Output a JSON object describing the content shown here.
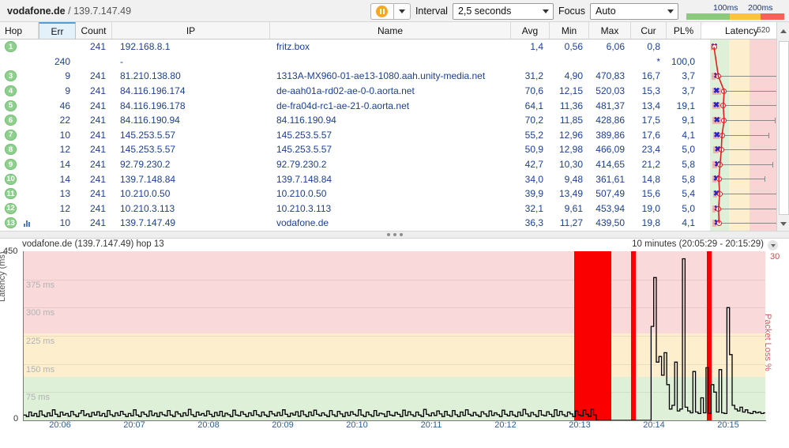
{
  "header": {
    "target_host": "vodafone.de",
    "separator": " / ",
    "target_ip": "139.7.147.49",
    "pause_icon": "pause-icon",
    "dropdown_icon": "chevron-down-icon",
    "interval_label": "Interval",
    "interval_value": "2,5 seconds",
    "focus_label": "Focus",
    "focus_value": "Auto",
    "legend": {
      "tick_100": "100ms",
      "tick_200": "200ms",
      "color_green": "#8cc97f",
      "color_amber": "#fbc343",
      "color_red": "#f4635a"
    }
  },
  "table": {
    "columns": [
      {
        "key": "hop",
        "label": "Hop",
        "sorted": false
      },
      {
        "key": "err",
        "label": "Err",
        "sorted": true
      },
      {
        "key": "count",
        "label": "Count",
        "sorted": false
      },
      {
        "key": "ip",
        "label": "IP",
        "sorted": false
      },
      {
        "key": "name",
        "label": "Name",
        "sorted": false
      },
      {
        "key": "avg",
        "label": "Avg",
        "sorted": false
      },
      {
        "key": "min",
        "label": "Min",
        "sorted": false
      },
      {
        "key": "max",
        "label": "Max",
        "sorted": false
      },
      {
        "key": "cur",
        "label": "Cur",
        "sorted": false
      },
      {
        "key": "pl",
        "label": "PL%",
        "sorted": false
      },
      {
        "key": "lat",
        "label": "Latency",
        "sorted": false
      }
    ],
    "latency_scale_max": "520",
    "rows": [
      {
        "hop": "1",
        "err": "",
        "count": "241",
        "ip": "192.168.8.1",
        "name": "fritz.box",
        "avg": "1,4",
        "min": "0,56",
        "max": "6,06",
        "cur": "0,8",
        "pl": "",
        "graph": {
          "avg_pct": 0.3,
          "min_pct": 0.1,
          "max_pct": 1.2,
          "cur_pct": 0.2
        }
      },
      {
        "hop": "",
        "err": "240",
        "count": "",
        "ip": "-",
        "name": "",
        "avg": "",
        "min": "",
        "max": "",
        "cur": "*",
        "pl": "100,0",
        "graph": null
      },
      {
        "hop": "3",
        "err": "9",
        "count": "241",
        "ip": "81.210.138.80",
        "name": "1313A-MX960-01-ae13-1080.aah.unity-media.net",
        "avg": "31,2",
        "min": "4,90",
        "max": "470,83",
        "cur": "16,7",
        "pl": "3,7",
        "graph": {
          "avg_pct": 6.0,
          "min_pct": 0.9,
          "max_pct": 90.5,
          "cur_pct": 3.2
        }
      },
      {
        "hop": "4",
        "err": "9",
        "count": "241",
        "ip": "84.116.196.174",
        "name": "de-aah01a-rd02-ae-0-0.aorta.net",
        "avg": "70,6",
        "min": "12,15",
        "max": "520,03",
        "cur": "15,3",
        "pl": "3,7",
        "graph": {
          "avg_pct": 13.6,
          "min_pct": 2.3,
          "max_pct": 100.0,
          "cur_pct": 2.9
        }
      },
      {
        "hop": "5",
        "err": "46",
        "count": "241",
        "ip": "84.116.196.178",
        "name": "de-fra04d-rc1-ae-21-0.aorta.net",
        "avg": "64,1",
        "min": "11,36",
        "max": "481,37",
        "cur": "13,4",
        "pl": "19,1",
        "graph": {
          "avg_pct": 12.3,
          "min_pct": 2.2,
          "max_pct": 92.6,
          "cur_pct": 2.6
        }
      },
      {
        "hop": "6",
        "err": "22",
        "count": "241",
        "ip": "84.116.190.94",
        "name": "84.116.190.94",
        "avg": "70,2",
        "min": "11,85",
        "max": "428,86",
        "cur": "17,5",
        "pl": "9,1",
        "graph": {
          "avg_pct": 13.5,
          "min_pct": 2.3,
          "max_pct": 82.5,
          "cur_pct": 3.4
        }
      },
      {
        "hop": "7",
        "err": "10",
        "count": "241",
        "ip": "145.253.5.57",
        "name": "145.253.5.57",
        "avg": "55,2",
        "min": "12,96",
        "max": "389,86",
        "cur": "17,6",
        "pl": "4,1",
        "graph": {
          "avg_pct": 10.6,
          "min_pct": 2.5,
          "max_pct": 75.0,
          "cur_pct": 3.4
        }
      },
      {
        "hop": "8",
        "err": "12",
        "count": "241",
        "ip": "145.253.5.57",
        "name": "145.253.5.57",
        "avg": "50,9",
        "min": "12,98",
        "max": "466,09",
        "cur": "23,4",
        "pl": "5,0",
        "graph": {
          "avg_pct": 9.8,
          "min_pct": 2.5,
          "max_pct": 89.6,
          "cur_pct": 4.5
        }
      },
      {
        "hop": "9",
        "err": "14",
        "count": "241",
        "ip": "92.79.230.2",
        "name": "92.79.230.2",
        "avg": "42,7",
        "min": "10,30",
        "max": "414,65",
        "cur": "21,2",
        "pl": "5,8",
        "graph": {
          "avg_pct": 8.2,
          "min_pct": 2.0,
          "max_pct": 79.7,
          "cur_pct": 4.1
        }
      },
      {
        "hop": "10",
        "err": "14",
        "count": "241",
        "ip": "139.7.148.84",
        "name": "139.7.148.84",
        "avg": "34,0",
        "min": "9,48",
        "max": "361,61",
        "cur": "14,8",
        "pl": "5,8",
        "graph": {
          "avg_pct": 6.5,
          "min_pct": 1.8,
          "max_pct": 69.5,
          "cur_pct": 2.8
        }
      },
      {
        "hop": "11",
        "err": "13",
        "count": "241",
        "ip": "10.210.0.50",
        "name": "10.210.0.50",
        "avg": "39,9",
        "min": "13,49",
        "max": "507,49",
        "cur": "15,6",
        "pl": "5,4",
        "graph": {
          "avg_pct": 7.7,
          "min_pct": 2.6,
          "max_pct": 97.6,
          "cur_pct": 3.0
        }
      },
      {
        "hop": "12",
        "err": "12",
        "count": "241",
        "ip": "10.210.3.113",
        "name": "10.210.3.113",
        "avg": "32,1",
        "min": "9,61",
        "max": "453,94",
        "cur": "19,0",
        "pl": "5,0",
        "graph": {
          "avg_pct": 6.2,
          "min_pct": 1.8,
          "max_pct": 87.3,
          "cur_pct": 3.7
        }
      },
      {
        "hop": "13",
        "err": "10",
        "count": "241",
        "ip": "139.7.147.49",
        "name": "vodafone.de",
        "avg": "36,3",
        "min": "11,27",
        "max": "439,50",
        "cur": "19,8",
        "pl": "4,1",
        "graph": {
          "avg_pct": 7.0,
          "min_pct": 2.2,
          "max_pct": 84.5,
          "cur_pct": 3.8
        },
        "selected": true
      }
    ]
  },
  "chart": {
    "title": "vodafone.de (139.7.147.49) hop 13",
    "range_label": "10 minutes (20:05:29 - 20:15:29)",
    "range_caret_icon": "chevron-down-icon",
    "chart_data": {
      "type": "line",
      "title": "vodafone.de (139.7.147.49) hop 13",
      "xlabel": "",
      "ylabel": "Latency (ms)",
      "y2label": "Packet Loss %",
      "ylim": [
        0,
        450
      ],
      "y2lim": [
        0,
        30
      ],
      "ytick_top_label": "450",
      "ytick_zero_label": "0",
      "y2_top_label": "30",
      "yticks": [
        "75 ms",
        "150 ms",
        "225 ms",
        "300 ms",
        "375 ms"
      ],
      "ytick_values": [
        75,
        150,
        225,
        300,
        375
      ],
      "xticks": [
        "20:06",
        "20:07",
        "20:08",
        "20:09",
        "20:10",
        "20:11",
        "20:12",
        "20:13",
        "20:14",
        "20:15"
      ],
      "grid": true,
      "bands": [
        {
          "name": "green",
          "range": [
            0,
            100
          ],
          "color": "#dff0d8"
        },
        {
          "name": "amber",
          "range": [
            100,
            225
          ],
          "color": "#fdeecd"
        },
        {
          "name": "red",
          "range": [
            225,
            450
          ],
          "color": "#f9d9d9"
        }
      ],
      "series": [
        {
          "name": "Latency (ms)",
          "color": "#000000",
          "values": [
            14,
            10,
            22,
            12,
            18,
            10,
            25,
            14,
            10,
            20,
            12,
            28,
            16,
            10,
            22,
            14,
            18,
            11,
            24,
            15,
            10,
            19,
            26,
            13,
            17,
            10,
            21,
            14,
            23,
            12,
            18,
            10,
            26,
            15,
            11,
            20,
            13,
            24,
            16,
            10,
            18,
            12,
            28,
            14,
            10,
            22,
            16,
            11,
            25,
            13,
            19,
            10,
            21,
            15,
            12,
            26,
            14,
            10,
            23,
            17,
            11,
            20,
            13,
            29,
            15,
            10,
            22,
            14,
            18,
            12,
            25,
            16,
            10,
            21,
            13,
            24,
            11,
            19,
            15,
            10,
            27,
            14,
            12,
            23,
            16,
            10,
            20,
            13,
            26,
            15,
            11,
            22,
            14,
            10,
            24,
            17,
            12,
            21,
            13,
            28,
            16,
            10,
            19,
            14,
            23,
            11,
            25,
            15,
            10,
            22,
            13,
            27,
            16,
            12,
            20,
            14,
            10,
            26,
            15,
            11,
            24,
            17,
            10,
            21,
            13,
            23,
            16,
            12,
            28,
            14,
            10,
            22,
            15,
            11,
            26,
            13,
            19,
            17,
            10,
            24,
            14,
            12,
            21,
            16,
            10,
            27,
            13,
            23,
            15,
            11,
            22,
            14,
            10,
            29,
            16,
            12,
            20,
            13,
            25,
            17,
            10,
            24,
            14,
            11,
            26,
            15,
            10,
            22,
            13,
            28,
            16,
            12,
            21,
            14,
            10,
            23,
            17,
            11,
            25,
            13,
            20,
            15,
            10,
            27,
            16,
            12,
            24,
            14,
            10,
            22,
            13,
            29,
            17,
            11,
            21,
            15,
            10,
            26,
            14,
            12,
            23,
            16,
            10,
            28,
            13,
            24,
            15,
            11,
            22,
            17,
            10,
            25,
            14,
            12,
            27,
            16,
            10,
            30,
            14,
            0,
            0,
            0,
            0,
            0,
            0,
            0,
            0,
            0,
            0,
            0,
            0,
            0,
            0,
            0,
            0,
            0,
            0,
            0,
            0,
            0,
            250,
            380,
            155,
            170,
            120,
            180,
            95,
            30,
            40,
            155,
            25,
            30,
            430,
            35,
            25,
            20,
            130,
            22,
            18,
            60,
            20,
            140,
            18,
            95,
            75,
            22,
            135,
            20,
            18,
            300,
            175,
            40,
            30,
            25,
            35,
            22,
            28,
            20,
            18,
            24,
            20,
            22,
            18,
            20
          ]
        },
        {
          "name": "Packet Loss %",
          "color": "#fb0000",
          "type": "bar",
          "events": [
            {
              "start_pct": 74.2,
              "width_pct": 5.0,
              "value": 100
            },
            {
              "start_pct": 81.8,
              "width_pct": 0.7,
              "value": 100
            },
            {
              "start_pct": 92.0,
              "width_pct": 0.7,
              "value": 100
            }
          ]
        }
      ]
    }
  }
}
